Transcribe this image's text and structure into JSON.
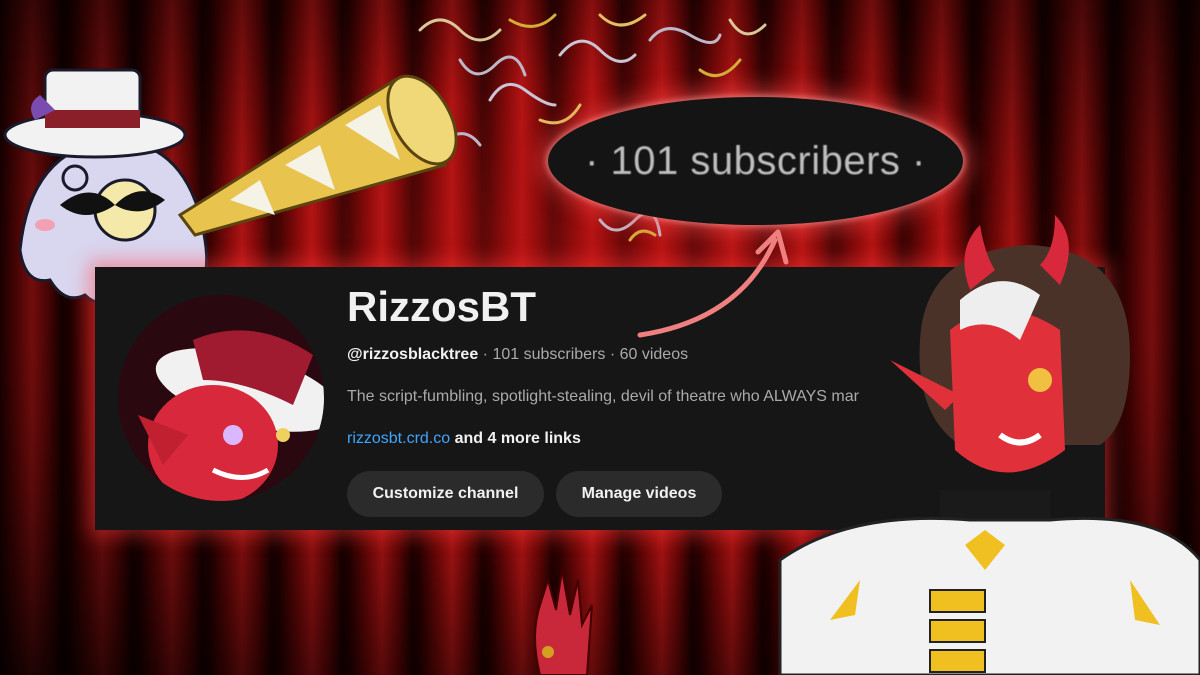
{
  "zoom": {
    "text": "· 101 subscribers ·"
  },
  "channel": {
    "name": "RizzosBT",
    "handle": "@rizzosblacktree",
    "stats": " · 101 subscribers · 60 videos",
    "description": "The script-fumbling, spotlight-stealing, devil of theatre who ALWAYS mar",
    "link": "rizzosbt.crd.co",
    "more_links": " and 4 more links"
  },
  "buttons": {
    "customize": "Customize channel",
    "manage": "Manage videos"
  },
  "colors": {
    "card_bg": "#161616",
    "link": "#3ea6ff",
    "curtain": "#b01414",
    "glow": "#ff5050"
  },
  "icons": [
    "ghost-mascot-icon",
    "party-horn-icon",
    "confetti-icon",
    "arrow-icon",
    "devil-character-icon",
    "avatar-image"
  ]
}
